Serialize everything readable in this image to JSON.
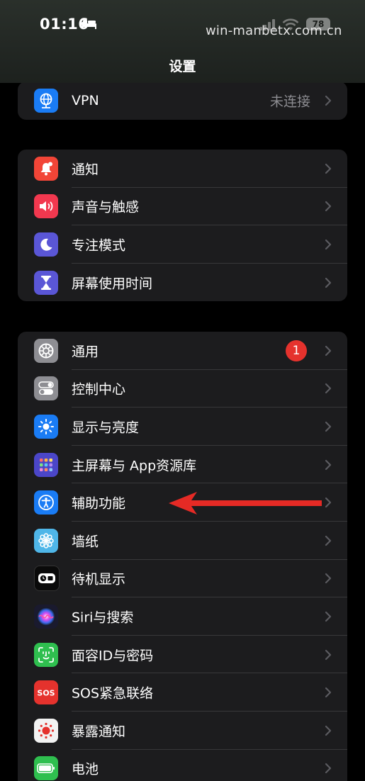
{
  "status_bar": {
    "time": "01:16",
    "battery": "78",
    "watermark": "win-manbetx.com.cn"
  },
  "nav": {
    "title": "设置"
  },
  "groups": [
    {
      "items": [
        {
          "label": "VPN",
          "value": "未连接",
          "icon": "vpn-globe-icon",
          "color": "#1a7cf5"
        }
      ]
    },
    {
      "items": [
        {
          "label": "通知",
          "icon": "bell-icon",
          "color": "#f24537"
        },
        {
          "label": "声音与触感",
          "icon": "speaker-icon",
          "color": "#f2384f"
        },
        {
          "label": "专注模式",
          "icon": "moon-icon",
          "color": "#5a56d6"
        },
        {
          "label": "屏幕使用时间",
          "icon": "hourglass-icon",
          "color": "#5a56d6"
        }
      ]
    },
    {
      "items": [
        {
          "label": "通用",
          "icon": "gear-icon",
          "color": "#8e8e93",
          "badge": "1"
        },
        {
          "label": "控制中心",
          "icon": "toggles-icon",
          "color": "#8e8e93"
        },
        {
          "label": "显示与亮度",
          "icon": "sun-icon",
          "color": "#1a7cf5"
        },
        {
          "label": "主屏幕与 App资源库",
          "icon": "app-grid-icon",
          "color": "#4b46c8"
        },
        {
          "label": "辅助功能",
          "icon": "accessibility-icon",
          "color": "#1a7cf5"
        },
        {
          "label": "墙纸",
          "icon": "flower-icon",
          "color": "#4fb6e8"
        },
        {
          "label": "待机显示",
          "icon": "standby-icon",
          "color": "#0a0a0a"
        },
        {
          "label": "Siri与搜索",
          "icon": "siri-icon",
          "color": "#1a1a2e"
        },
        {
          "label": "面容ID与密码",
          "icon": "face-id-icon",
          "color": "#2fbf4f"
        },
        {
          "label": "SOS紧急联络",
          "icon": "sos-icon",
          "color": "#e5322d"
        },
        {
          "label": "暴露通知",
          "icon": "exposure-icon",
          "color": "#f2f2f2"
        },
        {
          "label": "电池",
          "icon": "battery-icon",
          "color": "#2fbf4f"
        }
      ]
    }
  ],
  "annotation": {
    "arrow_color": "#e52a25",
    "arrow_icon": "arrow-left-icon"
  }
}
